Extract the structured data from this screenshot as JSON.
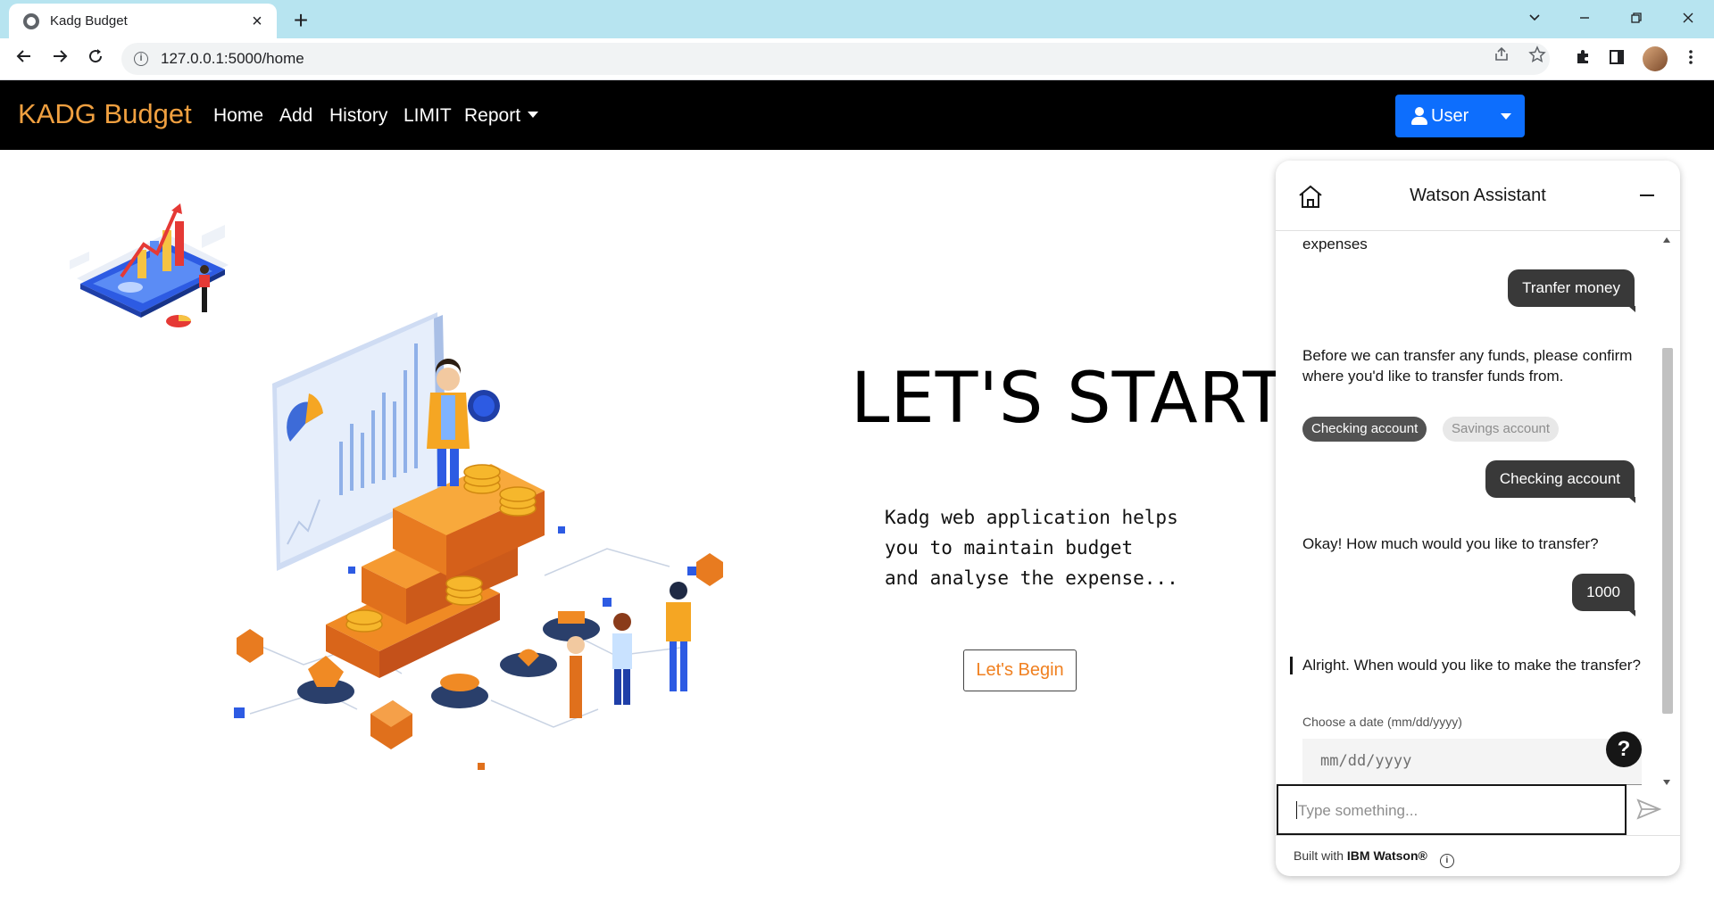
{
  "browser": {
    "tab_title": "Kadg Budget",
    "tab_close": "×",
    "new_tab": "+",
    "url": "127.0.0.1:5000/home"
  },
  "navbar": {
    "brand": "KADG Budget",
    "links": [
      "Home",
      "Add",
      "History",
      "LIMIT",
      "Report"
    ],
    "user_button": "User"
  },
  "hero": {
    "title": "LET'S START JOURNEY",
    "text": "Kadg web application helps\nyou to maintain budget\nand analyse the expense...",
    "button": "Let's Begin"
  },
  "assistant": {
    "title": "Watson Assistant",
    "messages": {
      "bot_0": "expenses",
      "user_1": "Tranfer money",
      "bot_1": "Before we can transfer any funds, please confirm where you'd like to transfer funds from.",
      "option_1": "Checking account",
      "option_2": "Savings account",
      "user_2": "Checking account",
      "bot_2": "Okay! How much would you like to transfer?",
      "user_3": "1000",
      "bot_3": "Alright. When would you like to make the transfer?",
      "date_label": "Choose a date (mm/dd/yyyy)",
      "date_placeholder": "mm/dd/yyyy"
    },
    "help": "?",
    "input_placeholder": "Type something...",
    "footer_prefix": "Built with ",
    "footer_brand": "IBM Watson®",
    "info": "i"
  },
  "colors": {
    "brand": "#f0a040",
    "user_button": "#0d6efd",
    "begin_text": "#f08020",
    "tab_strip": "#b7e4f0"
  }
}
